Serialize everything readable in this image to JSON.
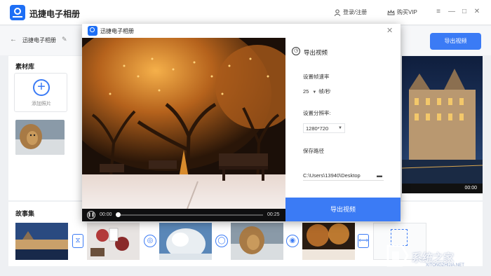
{
  "app": {
    "title": "迅捷电子相册",
    "login_label": "登录/注册",
    "vip_label": "购买VIP"
  },
  "subheader": {
    "album_name": "迅捷电子相册",
    "export_label": "导出视频"
  },
  "library": {
    "title": "素材库",
    "add_photo_label": "添加照片"
  },
  "preview": {
    "time": "00:00"
  },
  "story": {
    "title": "故事集"
  },
  "dialog": {
    "title": "迅捷电子相册",
    "player": {
      "current_time": "00:00",
      "duration": "00:25",
      "progress": 0.0
    },
    "settings": {
      "title": "导出视频",
      "frame_rate_label": "设置帧速率",
      "frame_rate_value": "25",
      "frame_rate_unit": "帧/秒",
      "resolution_label": "设置分辨率:",
      "resolution_value": "1280*720",
      "save_path_label": "保存路径",
      "save_path_value": "C:\\Users\\13940\\Desktop",
      "export_label": "导出视频"
    }
  },
  "watermark": {
    "text": "系统之家",
    "url": "XITONGZHIJIA.NET"
  },
  "colors": {
    "accent": "#3b7bf5"
  }
}
